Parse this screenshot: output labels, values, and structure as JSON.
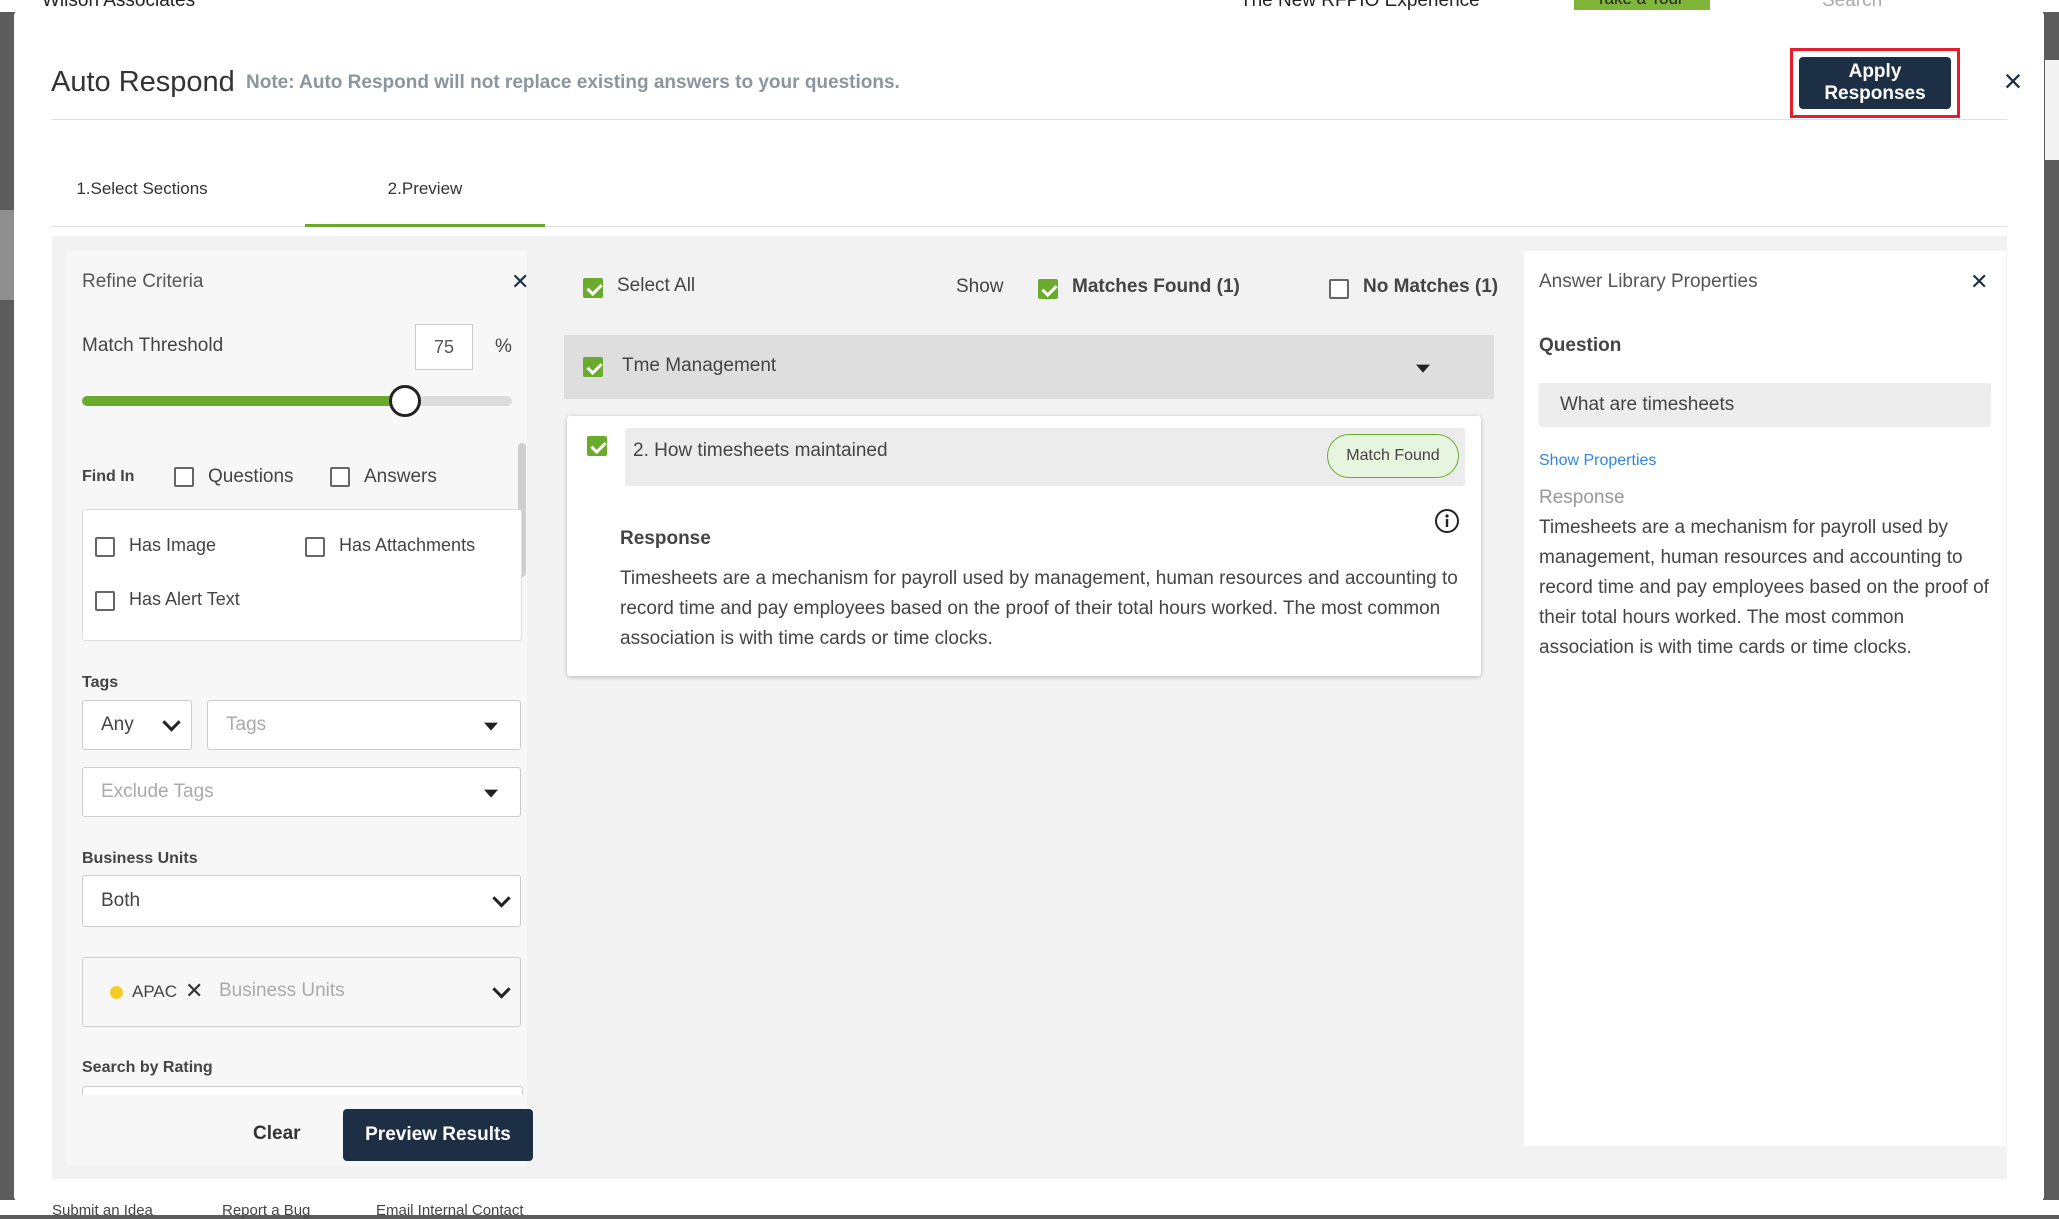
{
  "background": {
    "top_title_partial": "Wilson Associates",
    "experience_label": "The New RFPIO Experience",
    "tour_button": "Take a Tour",
    "search_placeholder": "Search",
    "bottom_links": [
      "Submit an Idea",
      "Report a Bug",
      "Email Internal Contact"
    ]
  },
  "modal": {
    "title": "Auto Respond",
    "note": "Note: Auto Respond will not replace existing answers to your questions.",
    "apply_label": "Apply Responses",
    "close_icon": "×"
  },
  "tabs": [
    {
      "label": "1.Select Sections",
      "active": false
    },
    {
      "label": "2.Preview",
      "active": true
    }
  ],
  "refine": {
    "title": "Refine Criteria",
    "close_icon": "✕",
    "match_threshold_label": "Match Threshold",
    "match_threshold_value": "75",
    "percent_sign": "%",
    "slider_fraction": 0.75,
    "find_in_label": "Find In",
    "questions_label": "Questions",
    "answers_label": "Answers",
    "has_image_label": "Has Image",
    "has_attachments_label": "Has Attachments",
    "has_alert_text_label": "Has Alert Text",
    "tags_label": "Tags",
    "tags_mode": "Any",
    "tags_placeholder": "Tags",
    "exclude_tags_placeholder": "Exclude Tags",
    "business_units_label": "Business Units",
    "business_units_value": "Both",
    "bu_chip": "APAC",
    "bu_placeholder": "Business Units",
    "search_by_rating_label": "Search by Rating",
    "clear_label": "Clear",
    "preview_label": "Preview Results"
  },
  "preview": {
    "select_all_label": "Select All",
    "show_label": "Show",
    "matches_found_label": "Matches Found (1)",
    "no_matches_label": "No Matches (1)",
    "section_name": "Tme Management",
    "question": "2. How timesheets maintained",
    "badge": "Match Found",
    "response_title": "Response",
    "response_text": "Timesheets are a mechanism for payroll used by management, human resources and accounting to record time and pay employees based on the proof of their total hours worked. The most common association is with time cards or time clocks."
  },
  "library": {
    "title": "Answer Library Properties",
    "close_icon": "✕",
    "question_label": "Question",
    "question_value": "What are timesheets",
    "show_properties": "Show Properties",
    "response_label": "Response",
    "response_text": "Timesheets are a mechanism for payroll used by management, human resources and accounting to record time and pay employees based on the proof of their total hours worked. The most common association is with time cards or time clocks."
  },
  "colors": {
    "accent_green": "#6aab2e",
    "navy": "#1d2f44",
    "highlight_red": "#e41e2b",
    "link_blue": "#2e86de"
  }
}
